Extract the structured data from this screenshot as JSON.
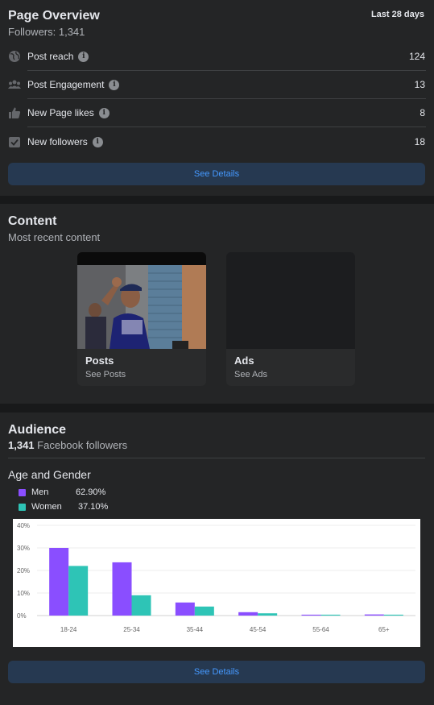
{
  "overview": {
    "title": "Page Overview",
    "followers_text": "Followers: 1,341",
    "range": "Last 28 days",
    "metrics": [
      {
        "icon": "globe-icon",
        "label": "Post reach",
        "value": "124"
      },
      {
        "icon": "people-icon",
        "label": "Post Engagement",
        "value": "13"
      },
      {
        "icon": "thumbs-up-icon",
        "label": "New Page likes",
        "value": "8"
      },
      {
        "icon": "checkbox-icon",
        "label": "New followers",
        "value": "18"
      }
    ],
    "button": "See Details",
    "info_glyph": "i"
  },
  "content": {
    "title": "Content",
    "subtitle": "Most recent content",
    "tiles": [
      {
        "title": "Posts",
        "subtitle": "See Posts"
      },
      {
        "title": "Ads",
        "subtitle": "See Ads"
      }
    ]
  },
  "audience": {
    "title": "Audience",
    "count": "1,341",
    "count_suffix": "Facebook followers",
    "section_title": "Age and Gender",
    "legend": [
      {
        "name": "Men",
        "value": "62.90%",
        "color": "#8a4eff"
      },
      {
        "name": "Women",
        "value": "37.10%",
        "color": "#2ec4b6"
      }
    ],
    "button": "See Details"
  },
  "chart_data": {
    "type": "bar",
    "categories": [
      "18-24",
      "25-34",
      "35-44",
      "45-54",
      "55-64",
      "65+"
    ],
    "series": [
      {
        "name": "Men",
        "color": "#8a4eff",
        "values": [
          30,
          23.6,
          5.8,
          1.5,
          0.4,
          0.5
        ]
      },
      {
        "name": "Women",
        "color": "#2ec4b6",
        "values": [
          22,
          9,
          4,
          1,
          0.4,
          0.4
        ]
      }
    ],
    "yticks": [
      "0%",
      "10%",
      "20%",
      "30%",
      "40%"
    ],
    "ylim": [
      0,
      40
    ],
    "grid": true,
    "title": "",
    "xlabel": "",
    "ylabel": ""
  }
}
